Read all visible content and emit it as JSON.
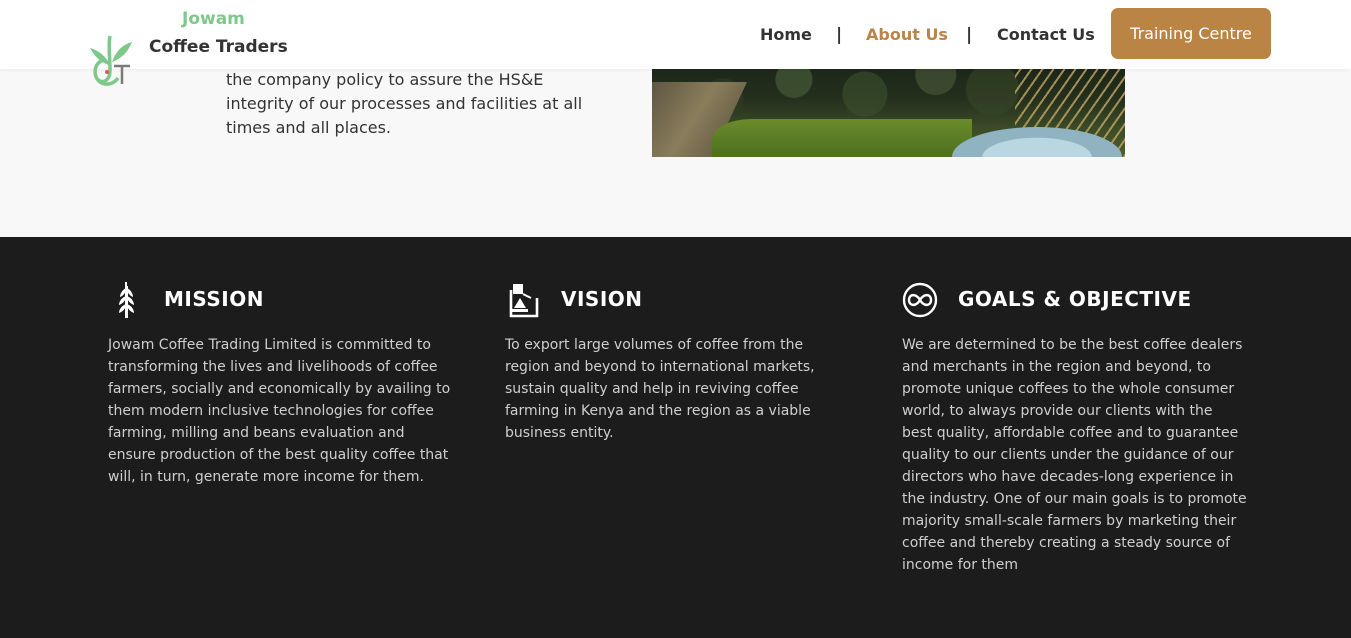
{
  "header": {
    "brand_top": "Jowam",
    "brand_bottom": "Coffee Traders",
    "logo_icon": "jct-coffee-plant-logo",
    "nav": [
      {
        "label": "Home",
        "active": false
      },
      {
        "label": "About Us",
        "active": true
      },
      {
        "label": "Contact Us",
        "active": false
      }
    ],
    "separator": "|",
    "cta_label": "Training Centre",
    "colors": {
      "accent": "#ba8544",
      "active_link": "#b9854a",
      "brand_green": "#7ec88a"
    }
  },
  "intro": {
    "text": "the company policy to assure the HS&E integrity of our processes and facilities at all times and all places.",
    "photo": "coffee-farm-photo"
  },
  "sections": [
    {
      "icon": "wheat-icon",
      "title": "MISSION",
      "text": "Jowam Coffee Trading Limited is committed to transforming the lives and livelihoods of coffee farmers, socially and economically by availing to them modern inclusive technologies for coffee farming, milling and beans evaluation and ensure production of the best quality coffee that will, in turn, generate more income for them."
    },
    {
      "icon": "vision-icon",
      "title": "VISION",
      "text": "To export large volumes of coffee from the region and beyond to international markets, sustain quality and help in reviving coffee farming in Kenya and the region as a viable business entity."
    },
    {
      "icon": "infinity-icon",
      "title": "GOALS & OBJECTIVE",
      "text": "We are determined to be the best coffee dealers and merchants in the region and beyond, to promote unique coffees to the whole consumer world, to always provide our clients with the best quality, affordable coffee and to guarantee quality to our clients under the guidance of our directors who have decades-long experience in the industry. One of our main goals is to promote majority small-scale farmers by marketing their coffee and thereby creating a steady source of income for them"
    }
  ]
}
